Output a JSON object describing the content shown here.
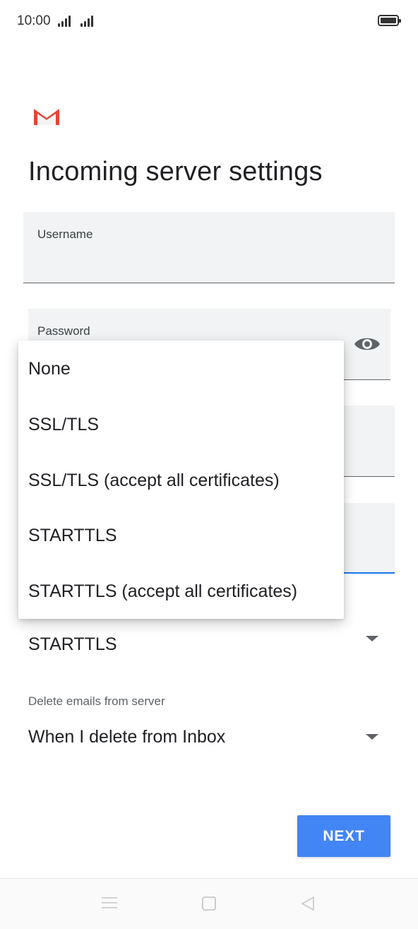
{
  "status_bar": {
    "time": "10:00"
  },
  "page": {
    "title": "Incoming server settings"
  },
  "fields": {
    "username_label": "Username",
    "password_label": "Password"
  },
  "security": {
    "selected": "STARTTLS"
  },
  "delete_emails": {
    "label": "Delete emails from server",
    "selected": "When I delete from Inbox"
  },
  "dropdown": {
    "options": [
      "None",
      "SSL/TLS",
      "SSL/TLS (accept all certificates)",
      "STARTTLS",
      "STARTTLS (accept all certificates)"
    ]
  },
  "buttons": {
    "next_label": "NEXT"
  },
  "icons": {
    "logo": "gmail-icon",
    "visibility": "eye-icon",
    "nav": [
      "menu-icon",
      "home-icon",
      "back-icon"
    ]
  },
  "colors": {
    "accent": "#4285f4",
    "focus_underline": "#1a73e8",
    "field_bg": "#f1f3f4",
    "gmail_red": "#ea4335"
  }
}
